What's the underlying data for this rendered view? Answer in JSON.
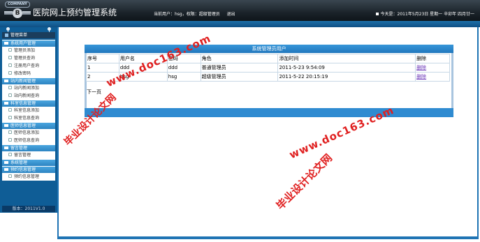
{
  "header": {
    "logo_text": "COMPANY",
    "logo_badge": "B",
    "app_title": "医院网上预约管理系统",
    "current_user": "当前用户：hsg，权限：超级管理员",
    "logout_label": "退出",
    "date_text": "今天是：2011年5月23日 星期一 辛卯年 四月廿一"
  },
  "sidebar": {
    "title": "管理菜单",
    "version": "版本：2011V1.0",
    "groups": [
      {
        "label": "系统用户管理",
        "items": [
          "管理员添加",
          "管理员查询",
          "注册用户查询",
          "修改密码"
        ]
      },
      {
        "label": "站内新闻管理",
        "items": [
          "站内新闻添加",
          "站内新闻查询"
        ]
      },
      {
        "label": "科室信息管理",
        "items": [
          "科室信息添加",
          "科室信息查询"
        ]
      },
      {
        "label": "医师信息管理",
        "items": [
          "医师信息添加",
          "医师信息查询"
        ]
      },
      {
        "label": "留言管理",
        "items": [
          "留言管理"
        ]
      },
      {
        "label": "系统管理",
        "items": []
      },
      {
        "label": "预约信息管理",
        "items": [
          "预约信息管理"
        ]
      }
    ]
  },
  "panel": {
    "title": "系统管理员用户",
    "columns": [
      "序号",
      "用户名",
      "密码",
      "角色",
      "添加时间",
      "删除"
    ],
    "rows": [
      {
        "no": "1",
        "username": "ddd",
        "password": "ddd",
        "role": "普通管理员",
        "added": "2011-5-23 9:54:09",
        "action": "删除"
      },
      {
        "no": "2",
        "username": "hsg",
        "password": "hsg",
        "role": "超级管理员",
        "added": "2011-5-22 20:15:19",
        "action": "删除"
      }
    ],
    "pager": "下一页"
  },
  "watermarks": {
    "site": "www.doc163.com",
    "name": "毕业设计论文网"
  }
}
